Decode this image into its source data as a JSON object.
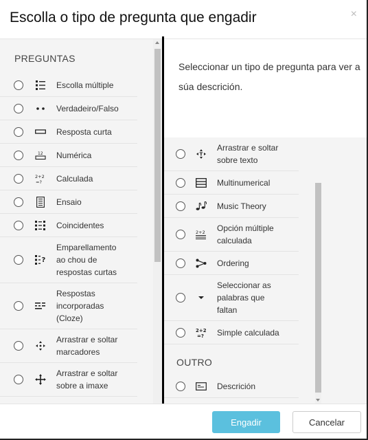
{
  "dialog": {
    "title": "Escolla o tipo de pregunta que engadir",
    "close_glyph": "×"
  },
  "left": {
    "heading": "PREGUNTAS",
    "items": [
      {
        "label": "Escolla múltiple",
        "icon": "multichoice-icon"
      },
      {
        "label": "Verdadeiro/Falso",
        "icon": "truefalse-icon"
      },
      {
        "label": "Resposta curta",
        "icon": "shortanswer-icon"
      },
      {
        "label": "Numérica",
        "icon": "numerical-icon"
      },
      {
        "label": "Calculada",
        "icon": "calculated-icon"
      },
      {
        "label": "Ensaio",
        "icon": "essay-icon"
      },
      {
        "label": "Coincidentes",
        "icon": "matching-icon"
      },
      {
        "label": "Emparellamento ao chou de respostas curtas",
        "icon": "random-match-icon"
      },
      {
        "label": "Respostas incorporadas (Cloze)",
        "icon": "cloze-icon"
      },
      {
        "label": "Arrastrar e soltar marcadores",
        "icon": "drag-markers-icon"
      },
      {
        "label": "Arrastrar e soltar sobre a imaxe",
        "icon": "drag-image-icon"
      }
    ]
  },
  "description": {
    "text": "Seleccionar un tipo de pregunta para ver a súa descrición."
  },
  "right": {
    "items": [
      {
        "label": "Arrastrar e soltar sobre texto",
        "icon": "drag-text-icon"
      },
      {
        "label": "Multinumerical",
        "icon": "multinumerical-icon"
      },
      {
        "label": "Music Theory",
        "icon": "music-icon"
      },
      {
        "label": "Opción múltiple calculada",
        "icon": "calc-multichoice-icon"
      },
      {
        "label": "Ordering",
        "icon": "ordering-icon"
      },
      {
        "label": "Seleccionar as palabras que faltan",
        "icon": "select-missing-icon"
      },
      {
        "label": "Simple calculada",
        "icon": "calc-simple-icon"
      }
    ],
    "other_heading": "OUTRO",
    "other_items": [
      {
        "label": "Descrición",
        "icon": "description-icon"
      }
    ]
  },
  "footer": {
    "add_label": "Engadir",
    "cancel_label": "Cancelar"
  },
  "colors": {
    "primary": "#5bc0de",
    "panel_bg": "#f4f4f4"
  }
}
